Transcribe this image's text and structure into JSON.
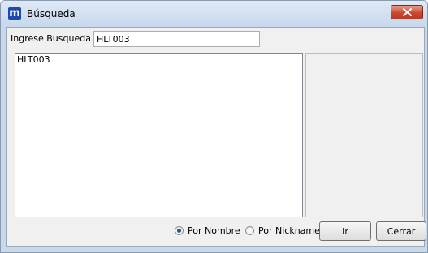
{
  "window": {
    "title": "Búsqueda",
    "app_icon_letter": "m",
    "icon": "app-logo-icon",
    "close_icon": "close-icon",
    "accent": "#1b4aa8",
    "close_color": "#c84a32"
  },
  "search": {
    "label": "Ingrese Busqueda",
    "value": "HLT003"
  },
  "results": {
    "items": [
      "HLT003"
    ]
  },
  "options": {
    "by_name_label": "Por Nombre",
    "by_nickname_label": "Por Nickname",
    "selected": "Por Nombre"
  },
  "buttons": {
    "go_label": "Ir",
    "close_label": "Cerrar"
  }
}
